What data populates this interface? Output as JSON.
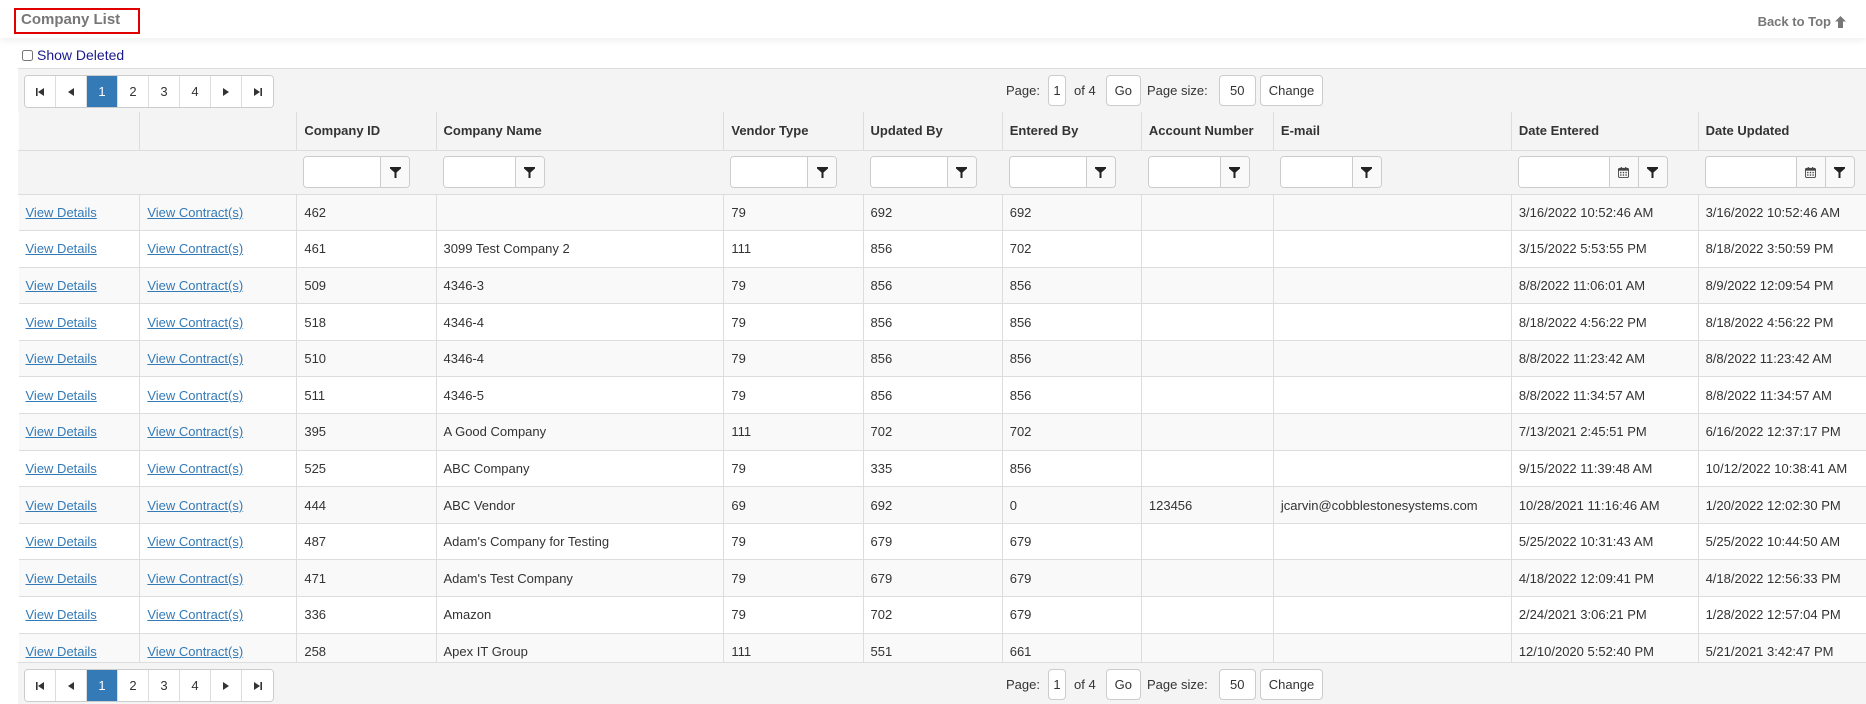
{
  "header": {
    "title": "Company List",
    "back_to_top": "Back to Top"
  },
  "show_deleted": {
    "label": "Show Deleted",
    "checked": false
  },
  "pager": {
    "pages": [
      "1",
      "2",
      "3",
      "4"
    ],
    "current_page": "1",
    "page_label": "Page:",
    "page_value": "1",
    "of_label": "of 4",
    "go_label": "Go",
    "page_size_label": "Page size:",
    "page_size_value": "50",
    "change_label": "Change",
    "icons": [
      "first-page-icon",
      "prev-page-icon",
      "next-page-icon",
      "last-page-icon"
    ]
  },
  "colors": {
    "accent": "#337ab7",
    "title_border": "#e00000"
  },
  "table": {
    "columns": [
      "",
      "",
      "Company ID",
      "Company Name",
      "Vendor Type",
      "Updated By",
      "Entered By",
      "Account Number",
      "E-mail",
      "Date Entered",
      "Date Updated"
    ],
    "link_details": "View Details",
    "link_contracts": "View Contract(s)",
    "rows": [
      [
        "462",
        "",
        "79",
        "692",
        "692",
        "",
        "",
        "3/16/2022 10:52:46 AM",
        "3/16/2022 10:52:46 AM"
      ],
      [
        "461",
        "3099 Test Company 2",
        "111",
        "856",
        "702",
        "",
        "",
        "3/15/2022 5:53:55 PM",
        "8/18/2022 3:50:59 PM"
      ],
      [
        "509",
        "4346-3",
        "79",
        "856",
        "856",
        "",
        "",
        "8/8/2022 11:06:01 AM",
        "8/9/2022 12:09:54 PM"
      ],
      [
        "518",
        "4346-4",
        "79",
        "856",
        "856",
        "",
        "",
        "8/18/2022 4:56:22 PM",
        "8/18/2022 4:56:22 PM"
      ],
      [
        "510",
        "4346-4",
        "79",
        "856",
        "856",
        "",
        "",
        "8/8/2022 11:23:42 AM",
        "8/8/2022 11:23:42 AM"
      ],
      [
        "511",
        "4346-5",
        "79",
        "856",
        "856",
        "",
        "",
        "8/8/2022 11:34:57 AM",
        "8/8/2022 11:34:57 AM"
      ],
      [
        "395",
        "A Good Company",
        "111",
        "702",
        "702",
        "",
        "",
        "7/13/2021 2:45:51 PM",
        "6/16/2022 12:37:17 PM"
      ],
      [
        "525",
        "ABC Company",
        "79",
        "335",
        "856",
        "",
        "",
        "9/15/2022 11:39:48 AM",
        "10/12/2022 10:38:41 AM"
      ],
      [
        "444",
        "ABC Vendor",
        "69",
        "692",
        "0",
        "123456",
        "jcarvin@cobblestonesystems.com",
        "10/28/2021 11:16:46 AM",
        "1/20/2022 12:02:30 PM"
      ],
      [
        "487",
        "Adam's Company for Testing",
        "79",
        "679",
        "679",
        "",
        "",
        "5/25/2022 10:31:43 AM",
        "5/25/2022 10:44:50 AM"
      ],
      [
        "471",
        "Adam's Test Company",
        "79",
        "679",
        "679",
        "",
        "",
        "4/18/2022 12:09:41 PM",
        "4/18/2022 12:56:33 PM"
      ],
      [
        "336",
        "Amazon",
        "79",
        "702",
        "679",
        "",
        "",
        "2/24/2021 3:06:21 PM",
        "1/28/2022 12:57:04 PM"
      ],
      [
        "258",
        "Apex IT Group",
        "111",
        "551",
        "661",
        "",
        "",
        "12/10/2020 5:52:40 PM",
        "5/21/2021 3:42:47 PM"
      ]
    ]
  }
}
